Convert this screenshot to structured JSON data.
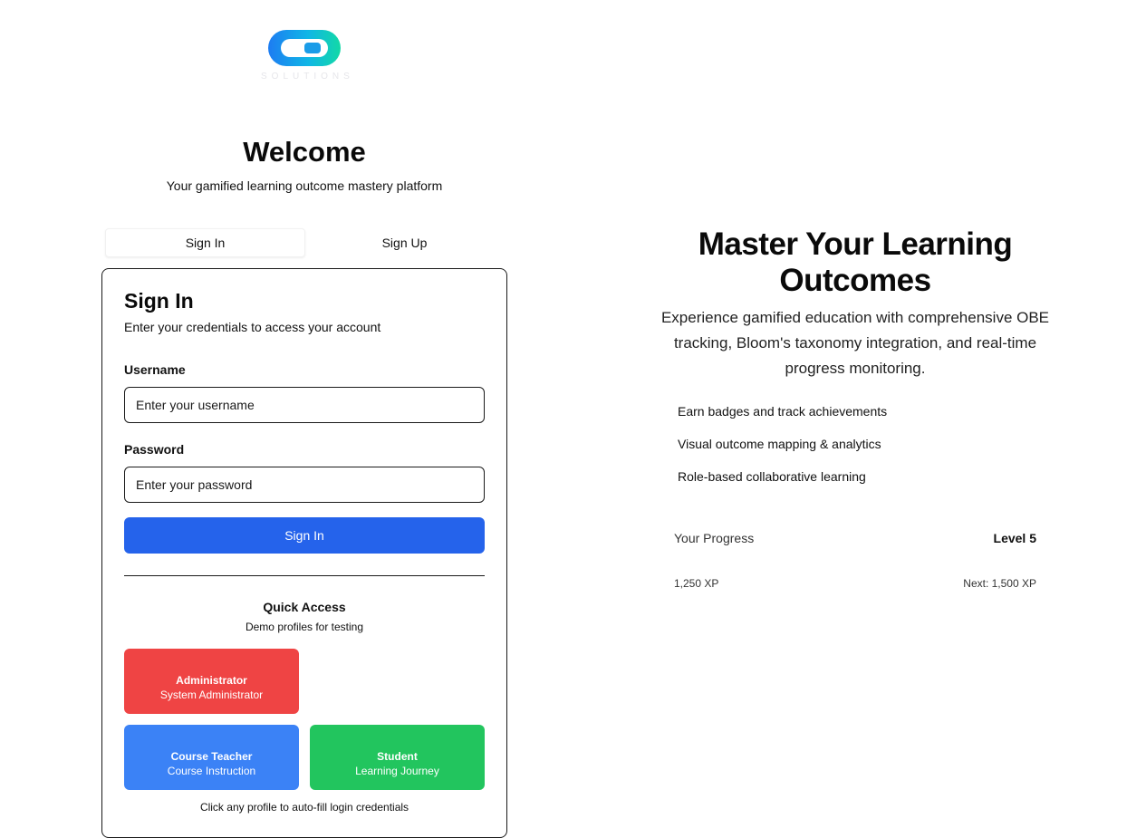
{
  "logo": {
    "text": "SOLUTIONS"
  },
  "header": {
    "title": "Welcome",
    "subtitle": "Your gamified learning outcome mastery platform"
  },
  "tabs": [
    {
      "label": "Sign In",
      "active": true
    },
    {
      "label": "Sign Up",
      "active": false
    }
  ],
  "signin": {
    "title": "Sign In",
    "description": "Enter your credentials to access your account",
    "username_label": "Username",
    "username_placeholder": "Enter your username",
    "password_label": "Password",
    "password_placeholder": "Enter your password",
    "submit_label": "Sign In"
  },
  "quick_access": {
    "title": "Quick Access",
    "subtitle": "Demo profiles for testing",
    "profiles": [
      {
        "role": "Administrator",
        "description": "System Administrator",
        "color": "#ef4444"
      },
      {
        "role": "Course Teacher",
        "description": "Course Instruction",
        "color": "#3b82f6"
      },
      {
        "role": "Student",
        "description": "Learning Journey",
        "color": "#22c55e"
      }
    ],
    "hint": "Click any profile to auto-fill login credentials"
  },
  "hero": {
    "title": "Master Your Learning Outcomes",
    "text": "Experience gamified education with comprehensive OBE tracking, Bloom's taxonomy integration, and real-time progress monitoring.",
    "features": [
      "Earn badges and track achievements",
      "Visual outcome mapping & analytics",
      "Role-based collaborative learning"
    ]
  },
  "progress": {
    "label": "Your Progress",
    "level": "Level 5",
    "current_xp": "1,250 XP",
    "next_xp": "Next: 1,500 XP"
  },
  "colors": {
    "primary": "#2563eb"
  }
}
